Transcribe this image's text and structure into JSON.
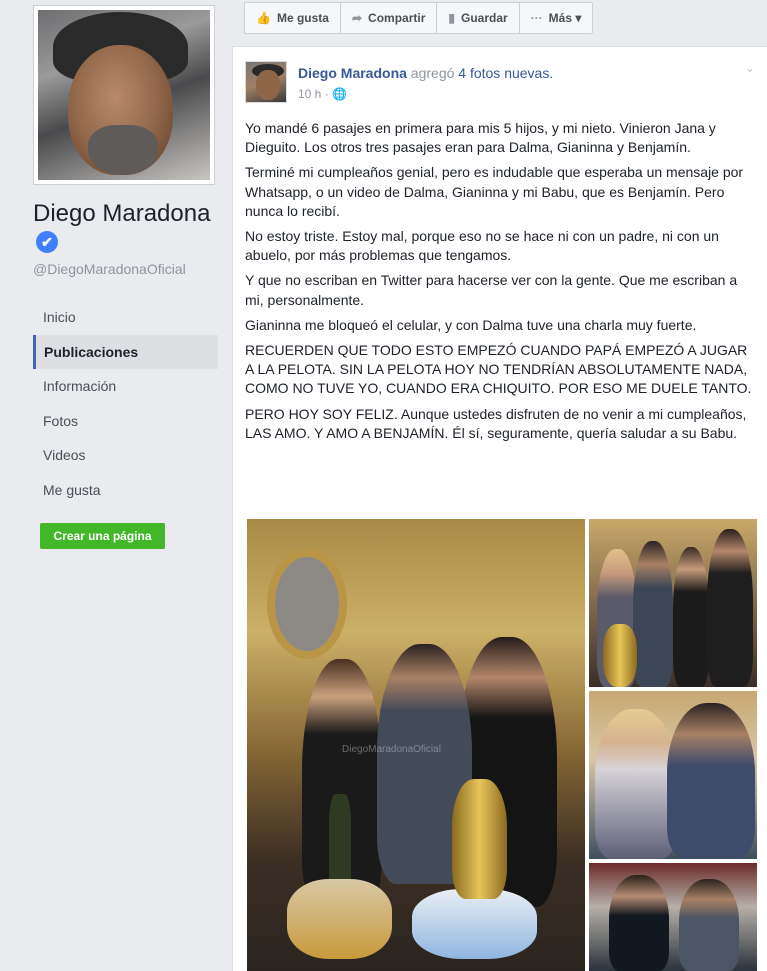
{
  "sidebar": {
    "page_name": "Diego Maradona",
    "verified_glyph": "✔",
    "handle": "@DiegoMaradonaOficial",
    "nav": [
      {
        "label": "Inicio",
        "active": false
      },
      {
        "label": "Publicaciones",
        "active": true
      },
      {
        "label": "Información",
        "active": false
      },
      {
        "label": "Fotos",
        "active": false
      },
      {
        "label": "Videos",
        "active": false
      },
      {
        "label": "Me gusta",
        "active": false
      }
    ],
    "create_page_label": "Crear una página"
  },
  "actions": [
    {
      "icon": "thumbs-up-icon",
      "glyph": "👍",
      "label": "Me gusta"
    },
    {
      "icon": "share-arrow-icon",
      "glyph": "➦",
      "label": "Compartir"
    },
    {
      "icon": "bookmark-icon",
      "glyph": "▮",
      "label": "Guardar"
    },
    {
      "icon": "more-dots-icon",
      "glyph": "···",
      "label": "Más ▾"
    }
  ],
  "post": {
    "author": "Diego Maradona",
    "action_text": "agregó",
    "photos_link": "4 fotos nuevas.",
    "time": "10 h",
    "audience_glyph": "·",
    "paragraphs": [
      "Yo mandé 6 pasajes en primera para mis 5 hijos, y mi nieto. Vinieron Jana y Dieguito. Los otros tres pasajes eran para Dalma, Gianinna y Benjamín.",
      "Terminé mi cumpleaños genial, pero es indudable que esperaba un mensaje por Whatsapp, o un video de Dalma, Gianinna y mi Babu, que es Benjamín. Pero nunca lo recibí.",
      "No estoy triste. Estoy mal, porque eso no se hace ni con un padre, ni con un abuelo, por más problemas que tengamos.",
      "Y que no escriban en Twitter para hacerse ver con la gente. Que me escriban a mi, personalmente.",
      "Gianinna me bloqueó el celular, y con Dalma tuve una charla muy fuerte.",
      "RECUERDEN QUE TODO ESTO EMPEZÓ CUANDO PAPÁ EMPEZÓ A JUGAR A LA PELOTA. SIN LA PELOTA HOY NO TENDRÍAN ABSOLUTAMENTE NADA, COMO NO TUVE YO, CUANDO ERA CHIQUITO. POR ESO ME DUELE TANTO.",
      "PERO HOY SOY FELIZ. Aunque ustedes disfruten de no venir a mi cumpleaños, LAS AMO. Y AMO A BENJAMÍN. Él sí, seguramente, quería saludar a su Babu."
    ],
    "watermark": "DiegoMaradonaOficial"
  }
}
